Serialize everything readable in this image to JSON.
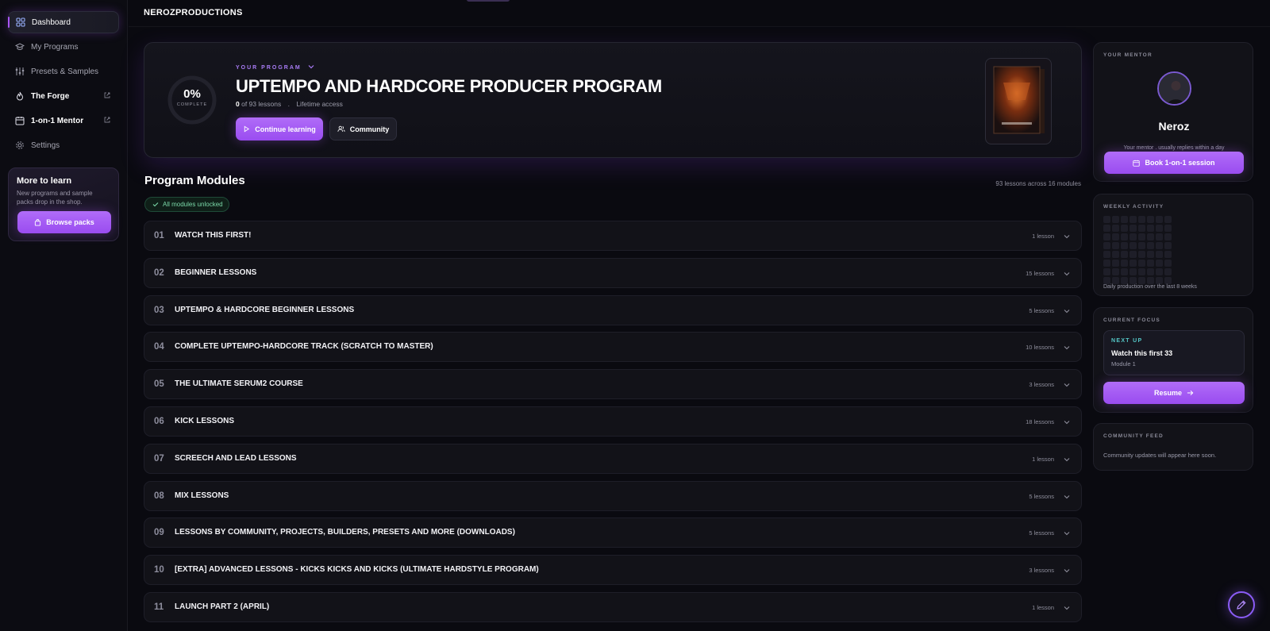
{
  "sidebar": {
    "items": [
      {
        "label": "Dashboard",
        "icon": "grid-icon"
      },
      {
        "label": "My Programs",
        "icon": "graduation-cap-icon"
      },
      {
        "label": "Presets & Samples",
        "icon": "sliders-icon"
      },
      {
        "label": "The Forge",
        "icon": "flame-icon"
      },
      {
        "label": "1-on-1 Mentor",
        "icon": "calendar-icon"
      },
      {
        "label": "Settings",
        "icon": "gear-icon"
      }
    ],
    "learn_card": {
      "title": "More to learn",
      "text": "New programs and sample packs drop in the shop.",
      "button": "Browse packs"
    }
  },
  "header": {
    "brand": "NEROZPRODUCTIONS"
  },
  "hero": {
    "progress_percent": "0%",
    "progress_label": "COMPLETE",
    "eyebrow": "YOUR PROGRAM",
    "title": "UPTEMPO AND HARDCORE PRODUCER PROGRAM",
    "completed": "0",
    "meta_rest": "of 93 lessons",
    "meta_sep": ".",
    "access": "Lifetime access",
    "continue_button": "Continue learning",
    "community_button": "Community"
  },
  "modules": {
    "title": "Program Modules",
    "count_text": "93 lessons across 16 modules",
    "unlocked_badge": "All modules unlocked",
    "items": [
      {
        "num": "01",
        "title": "WATCH THIS FIRST!",
        "lessons": "1 lesson"
      },
      {
        "num": "02",
        "title": "BEGINNER LESSONS",
        "lessons": "15 lessons"
      },
      {
        "num": "03",
        "title": "UPTEMPO & HARDCORE BEGINNER LESSONS",
        "lessons": "5 lessons"
      },
      {
        "num": "04",
        "title": "COMPLETE UPTEMPO-HARDCORE TRACK (SCRATCH TO MASTER)",
        "lessons": "10 lessons"
      },
      {
        "num": "05",
        "title": "THE ULTIMATE SERUM2 COURSE",
        "lessons": "3 lessons"
      },
      {
        "num": "06",
        "title": "KICK LESSONS",
        "lessons": "18 lessons"
      },
      {
        "num": "07",
        "title": "SCREECH AND LEAD LESSONS",
        "lessons": "1 lesson"
      },
      {
        "num": "08",
        "title": "MIX LESSONS",
        "lessons": "5 lessons"
      },
      {
        "num": "09",
        "title": "LESSONS BY COMMUNITY, PROJECTS, BUILDERS, PRESETS AND MORE (DOWNLOADS)",
        "lessons": "5 lessons"
      },
      {
        "num": "10",
        "title": "[EXTRA] ADVANCED LESSONS - KICKS KICKS AND KICKS (ULTIMATE HARDSTYLE PROGRAM)",
        "lessons": "3 lessons"
      },
      {
        "num": "11",
        "title": "LAUNCH PART 2 (APRIL)",
        "lessons": "1 lesson"
      }
    ]
  },
  "mentor": {
    "label": "YOUR MENTOR",
    "name": "Neroz",
    "subtitle": "Your mentor . usually replies within a day",
    "button": "Book 1-on-1 session"
  },
  "weekly": {
    "label": "WEEKLY ACTIVITY",
    "subtitle": "Daily production over the last 8 weeks"
  },
  "focus": {
    "label": "CURRENT FOCUS",
    "next_up": "NEXT UP",
    "title": "Watch this first 33",
    "module": "Module 1",
    "button": "Resume"
  },
  "feed": {
    "label": "COMMUNITY FEED",
    "text": "Community updates will appear here soon."
  },
  "colors": {
    "accent": "#a855f7",
    "background": "#0a0a10",
    "success": "#7ad8a8",
    "next_up": "#55c8c8"
  }
}
